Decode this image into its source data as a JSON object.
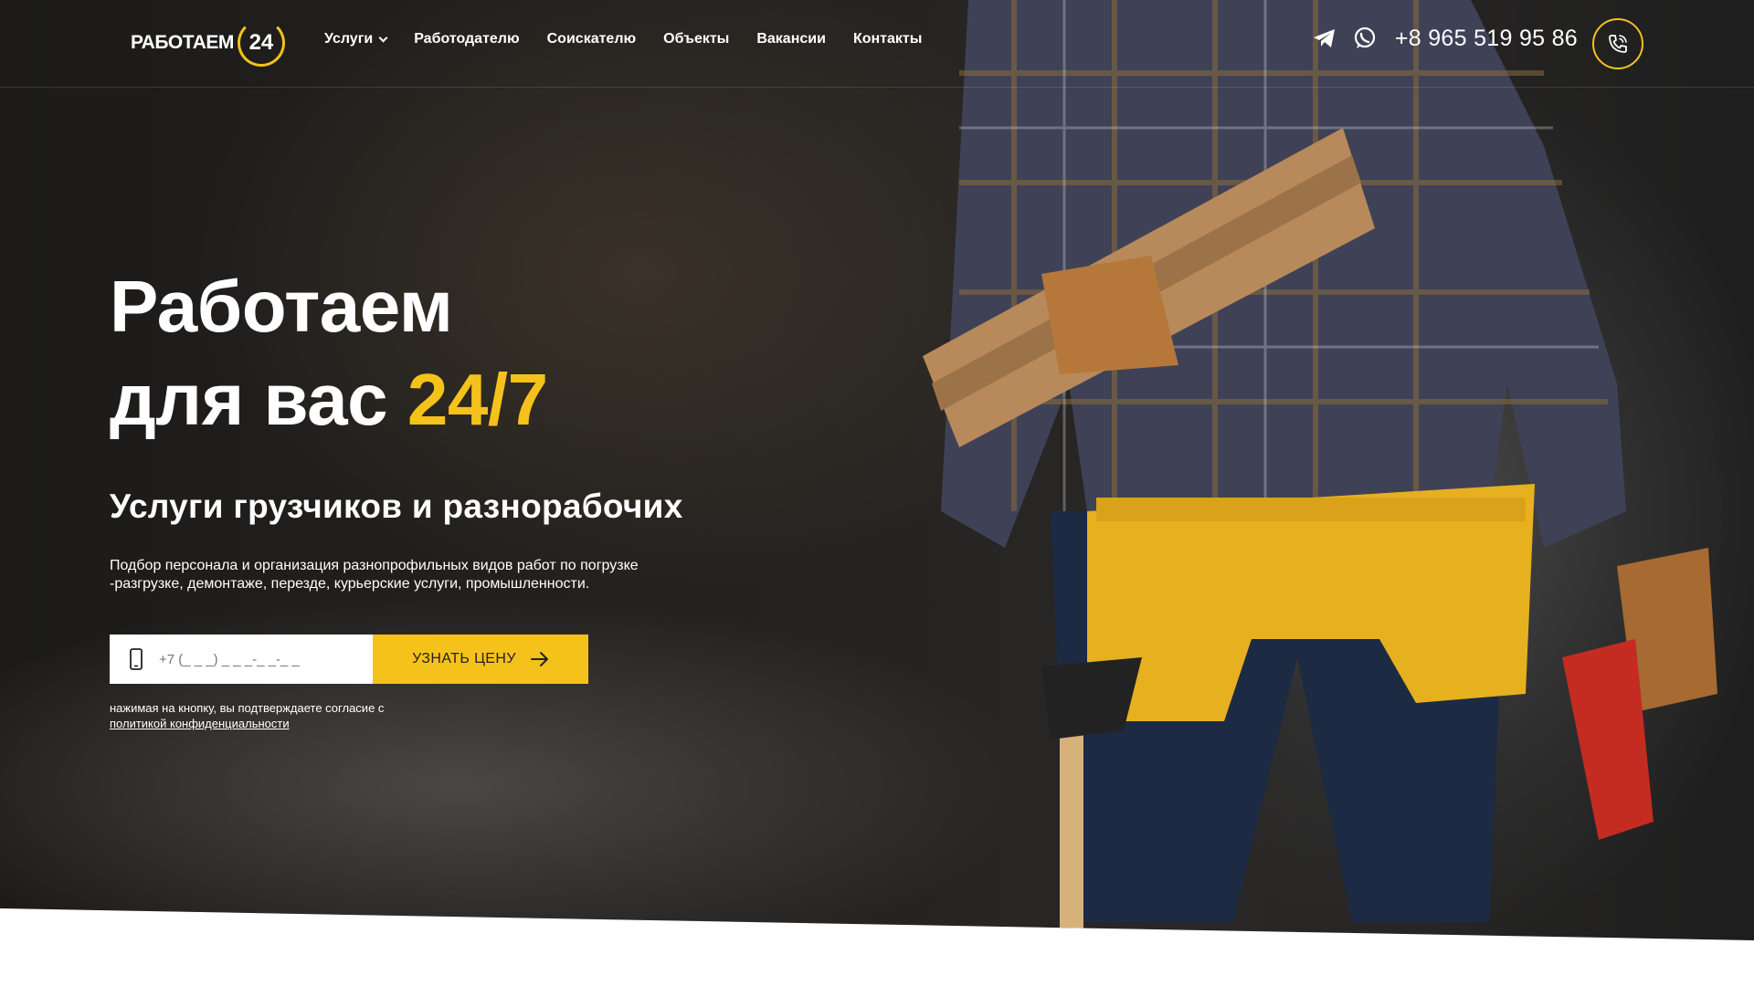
{
  "brand": {
    "name": "РАБОТАЕМ",
    "badge": "24",
    "accent": "#f5c21b"
  },
  "nav": [
    {
      "label": "Услуги",
      "has_dropdown": true
    },
    {
      "label": "Работодателю"
    },
    {
      "label": "Соискателю"
    },
    {
      "label": "Объекты"
    },
    {
      "label": "Вакансии"
    },
    {
      "label": "Контакты"
    }
  ],
  "header": {
    "phone": "+8 965 519 95 86",
    "icons": [
      "telegram-icon",
      "whatsapp-icon",
      "phone-call-icon"
    ]
  },
  "hero": {
    "title_line1": "Работаем",
    "title_line2": "для вас",
    "title_accent": "24/7",
    "subtitle": "Услуги грузчиков и разнорабочих",
    "description": "Подбор персонала и организация разнопрофильных видов работ по погрузке -разгрузке, демонтаже, перезде, курьерские услуги, промышленности."
  },
  "form": {
    "phone_placeholder": "+7 (_ _ _) _ _ _-_ _-_ _",
    "submit_label": "УЗНАТЬ ЦЕНУ",
    "consent_text": "нажимая на кнопку, вы подтверждаете согласие с",
    "consent_link": "политикой конфиденциальности"
  }
}
